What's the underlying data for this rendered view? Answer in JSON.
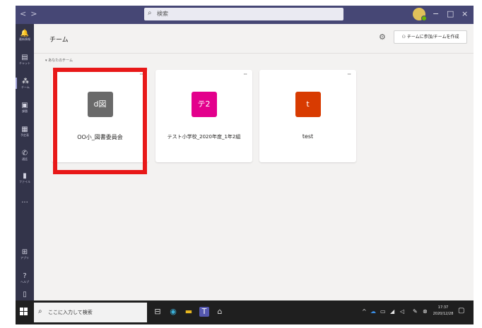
{
  "window": {
    "nav_back": "<",
    "nav_forward": ">",
    "search_placeholder": "検索",
    "minimize": "−",
    "maximize": "□",
    "close": "×"
  },
  "rail": {
    "items": [
      {
        "label": "最新情報",
        "icon": "bell-icon",
        "glyph": "🔔"
      },
      {
        "label": "チャット",
        "icon": "chat-icon",
        "glyph": "▤"
      },
      {
        "label": "チーム",
        "icon": "teams-icon",
        "glyph": "⁂"
      },
      {
        "label": "課題",
        "icon": "assignments-icon",
        "glyph": "▣"
      },
      {
        "label": "予定表",
        "icon": "calendar-icon",
        "glyph": "▦"
      },
      {
        "label": "通話",
        "icon": "phone-icon",
        "glyph": "✆"
      },
      {
        "label": "ファイル",
        "icon": "file-icon",
        "glyph": "▮"
      },
      {
        "label": "",
        "icon": "more-icon",
        "glyph": "···"
      }
    ],
    "bottom": [
      {
        "label": "アプリ",
        "icon": "apps-icon",
        "glyph": "⊞"
      },
      {
        "label": "ヘルプ",
        "icon": "help-icon",
        "glyph": "?"
      },
      {
        "label": "",
        "icon": "device-icon",
        "glyph": "▯"
      }
    ]
  },
  "header": {
    "title": "チーム",
    "join_create_label": "チームに参加/チームを作成"
  },
  "section": {
    "label": "あなたのチーム"
  },
  "teams": [
    {
      "initials": "d図",
      "name": "OO小_図書委員会",
      "color": "#6a6a6a",
      "more": "···"
    },
    {
      "initials": "テ2",
      "name": "テスト小学校_2020年度_1年2組",
      "color": "#e3008c",
      "more": "···"
    },
    {
      "initials": "t",
      "name": "test",
      "color": "#d83b01",
      "more": "···"
    }
  ],
  "taskbar": {
    "search_placeholder": "ここに入力して検索",
    "clock_time": "17:37",
    "clock_date": "2020/12/28"
  },
  "colors": {
    "titlebar": "#464775",
    "rail": "#33344a",
    "highlight": "#e81818"
  }
}
